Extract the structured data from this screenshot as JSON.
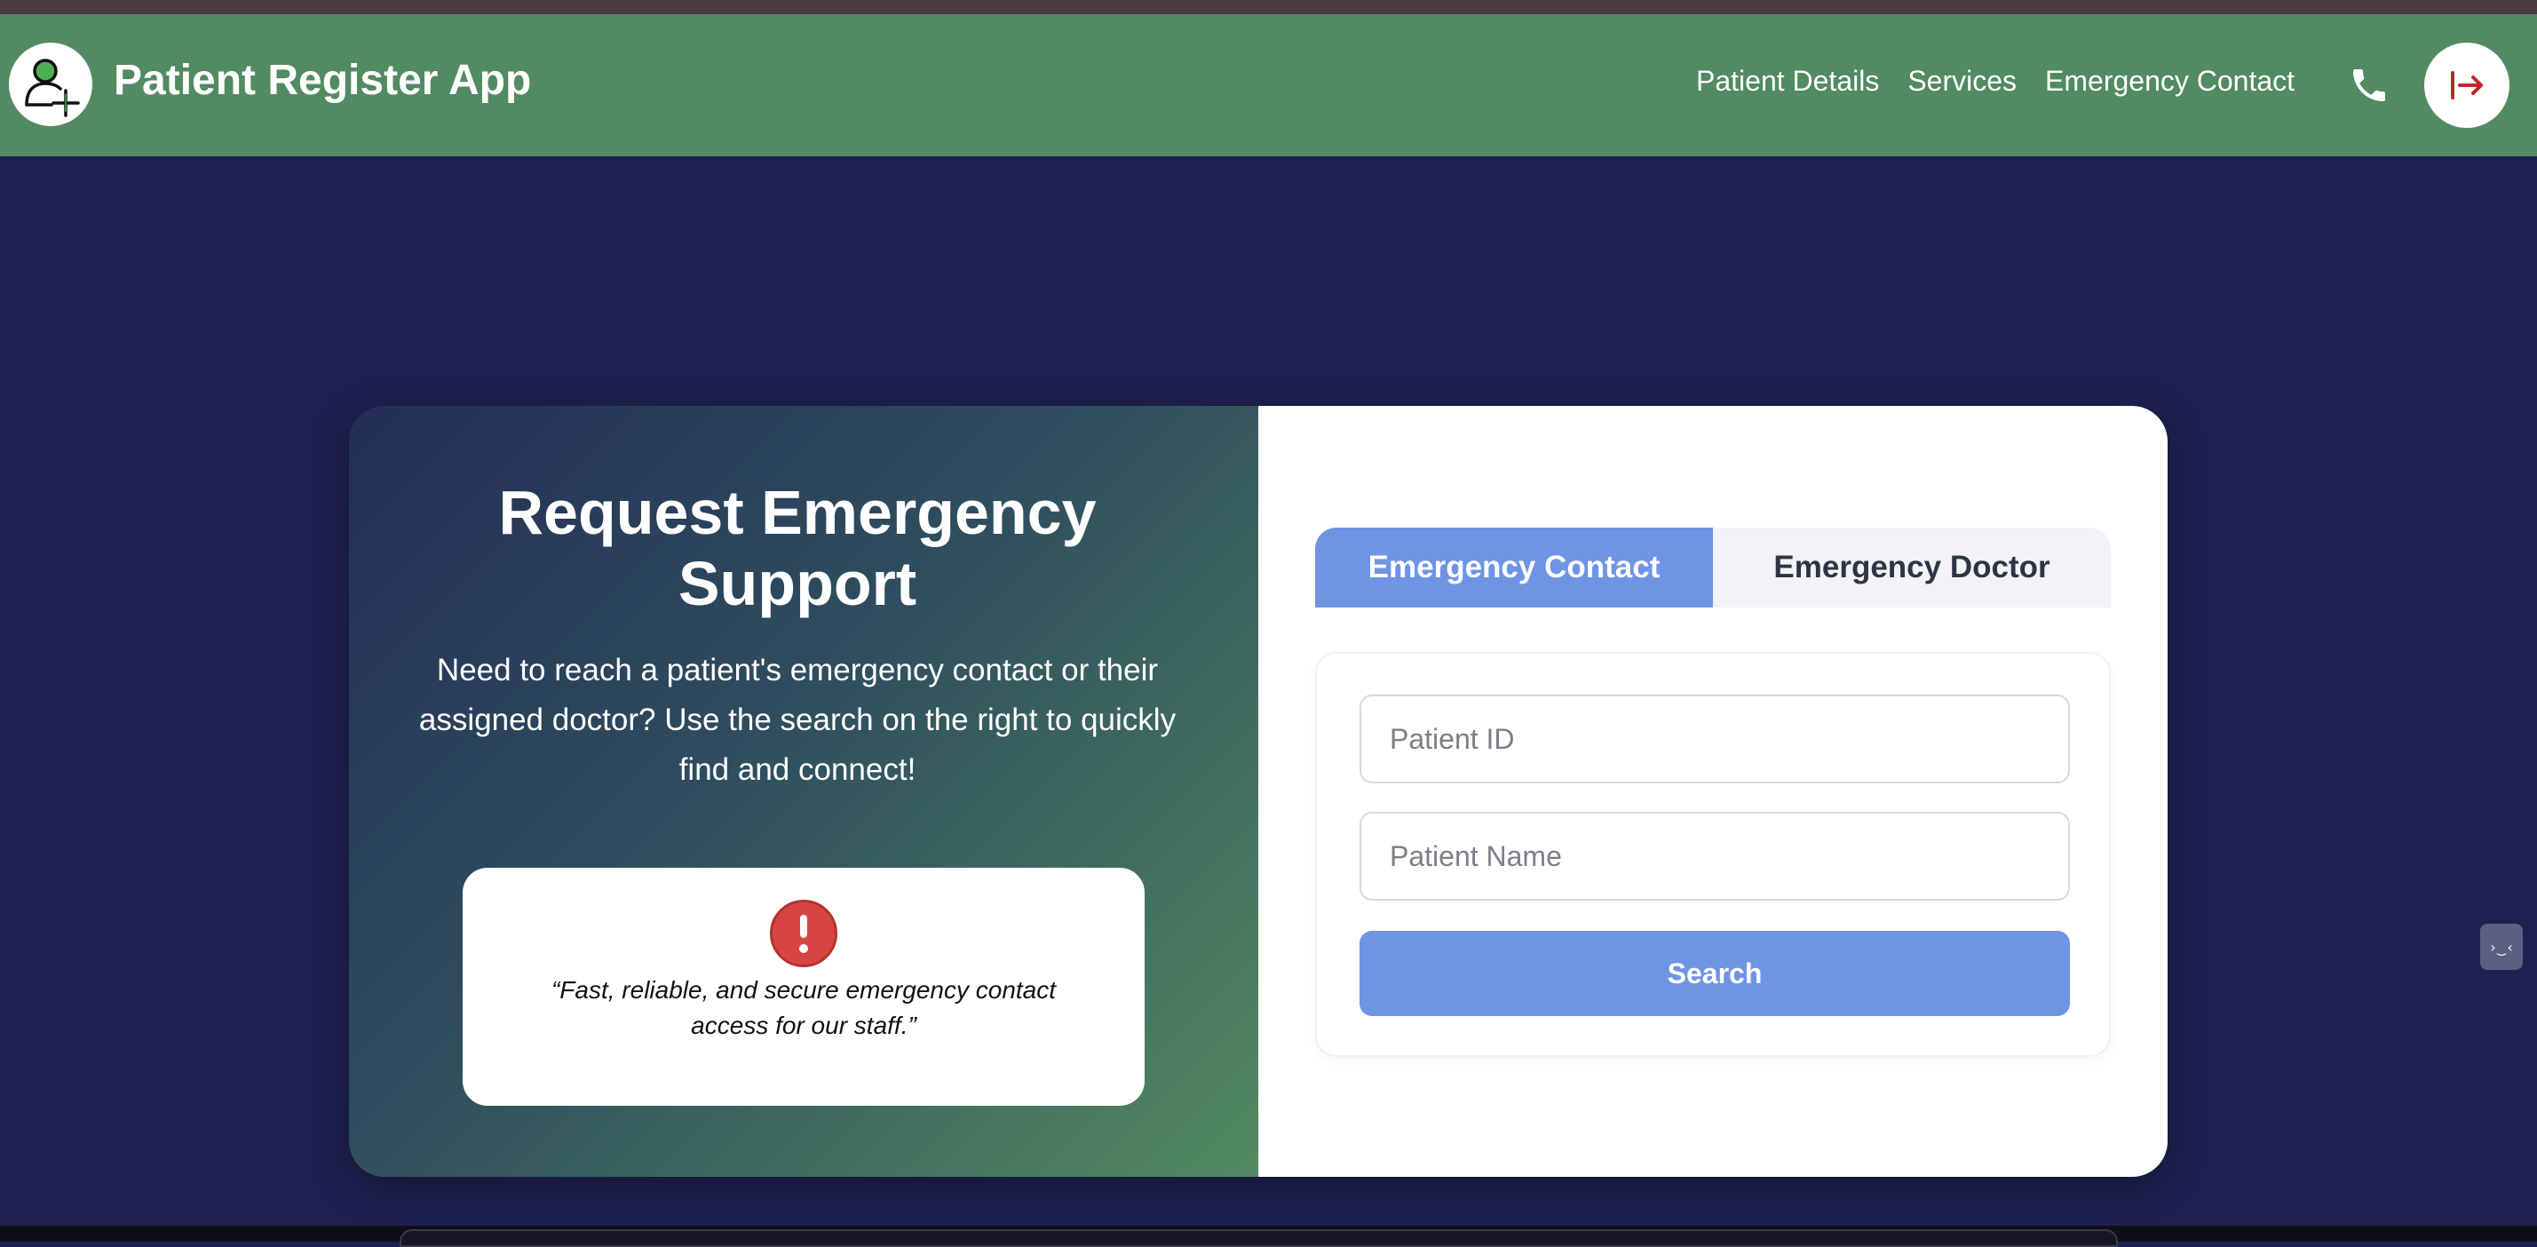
{
  "app": {
    "title": "Patient Register App"
  },
  "nav": {
    "links": [
      "Patient Details",
      "Services",
      "Emergency Contact"
    ],
    "phone_icon": "phone-icon",
    "logout_icon": "logout-icon"
  },
  "hero": {
    "heading": "Request Emergency Support",
    "subtext": "Need to reach a patient's emergency contact or their assigned doctor? Use the search on the right to quickly find and connect!",
    "quote": "“Fast, reliable, and secure emergency contact access for our staff.”",
    "alert_icon": "alert-icon"
  },
  "tabs": {
    "active": "Emergency Contact",
    "inactive": "Emergency Doctor"
  },
  "form": {
    "patient_id_placeholder": "Patient ID",
    "patient_name_placeholder": "Patient Name",
    "search_label": "Search"
  },
  "colors": {
    "navbar": "#528a61",
    "background": "#1e2150",
    "accent": "#6f94e4",
    "alert": "#d64541",
    "logout_icon": "#c0262c"
  }
}
